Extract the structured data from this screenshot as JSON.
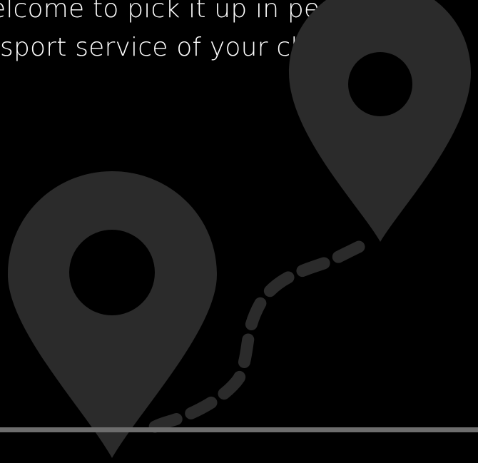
{
  "intro_text": {
    "line_1": "elcome to pick it up in person",
    "line_2": "sport service of your choosing."
  },
  "illustration": {
    "icon_names": [
      "map-pin-icon",
      "map-pin-icon",
      "dashed-route-icon"
    ],
    "fill_color": "#2b2b2b",
    "background_color": "#000000"
  },
  "divider": {
    "color": "#6d6d6d"
  }
}
